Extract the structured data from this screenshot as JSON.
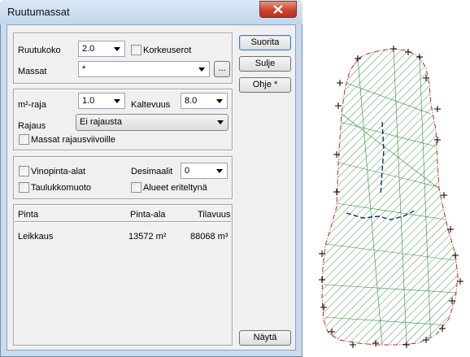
{
  "window": {
    "title": "Ruutumassat"
  },
  "section1": {
    "ruutukoko_label": "Ruutukoko",
    "ruutukoko_value": "2.0",
    "korkeuserot_label": "Korkeuserot",
    "massat_label": "Massat",
    "massat_value": "*",
    "browse_label": "..."
  },
  "section2": {
    "m2raja_label": "m²-raja",
    "m2raja_value": "1.0",
    "kaltevuus_label": "Kaltevuus",
    "kaltevuus_value": "8.0",
    "rajaus_label": "Rajaus",
    "rajaus_value": "Ei rajausta",
    "massat_rajaus_label": "Massat rajausviivoille"
  },
  "section3": {
    "vinopinta_label": "Vinopinta-alat",
    "desimaalit_label": "Desimaalit",
    "desimaalit_value": "0",
    "taulukko_label": "Taulukkomuoto",
    "alueet_label": "Alueet eriteltynä"
  },
  "results": {
    "headers": [
      "Pinta",
      "Pinta-ala",
      "Tilavuus"
    ],
    "rows": [
      {
        "pinta": "Leikkaus",
        "ala": "13572 m²",
        "tilavuus": "88068 m³"
      }
    ]
  },
  "buttons": {
    "suorita": "Suorita",
    "sulje": "Sulje",
    "ohje": "Ohje *",
    "nayta": "Näytä"
  },
  "colors": {
    "hatch": "#2e8b3a",
    "outline": "#cc2222",
    "inner_line": "#1a2a6c"
  }
}
